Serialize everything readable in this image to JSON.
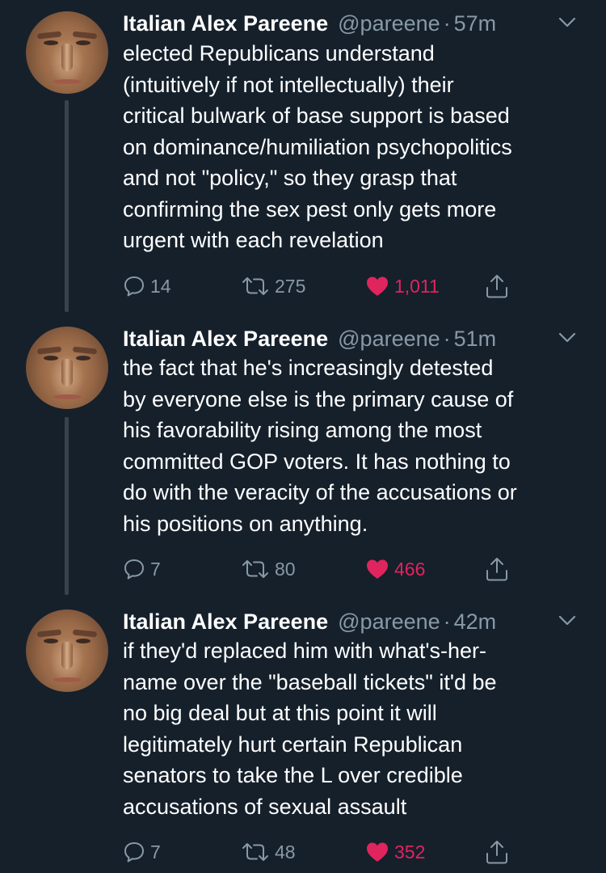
{
  "tweets": [
    {
      "name": "Italian Alex Pareene",
      "handle": "@pareene",
      "separator": "·",
      "time": "57m",
      "lines": [
        "elected Republicans understand",
        "(intuitively if not intellectually) their",
        "critical bulwark of base support is based",
        "on dominance/humiliation psychopolitics",
        "and not \"policy,\" so they grasp that",
        "confirming the sex pest only gets more",
        "urgent with each revelation"
      ],
      "replies": "14",
      "retweets": "275",
      "likes": "1,011"
    },
    {
      "name": "Italian Alex Pareene",
      "handle": "@pareene",
      "separator": "·",
      "time": "51m",
      "lines": [
        "the fact that he's increasingly detested",
        "by everyone else is the primary cause of",
        "his favorability rising among the most",
        "committed GOP voters. It has nothing to",
        "do with the veracity of the accusations or",
        "his positions on anything."
      ],
      "replies": "7",
      "retweets": "80",
      "likes": "466"
    },
    {
      "name": "Italian Alex Pareene",
      "handle": "@pareene",
      "separator": "·",
      "time": "42m",
      "lines": [
        "if they'd replaced him with what's-her-",
        "name over the \"baseball tickets\" it'd be",
        "no big deal but at this point it will",
        "legitimately hurt certain Republican",
        "senators to take the L over credible",
        "accusations of sexual assault"
      ],
      "replies": "7",
      "retweets": "48",
      "likes": "352"
    }
  ],
  "colors": {
    "background": "#15202b",
    "text": "#ffffff",
    "secondary": "#8899a6",
    "like": "#e0245e",
    "thread_line": "#38444d"
  },
  "icons": [
    "reply-icon",
    "retweet-icon",
    "heart-icon",
    "share-icon",
    "chevron-down-icon"
  ]
}
